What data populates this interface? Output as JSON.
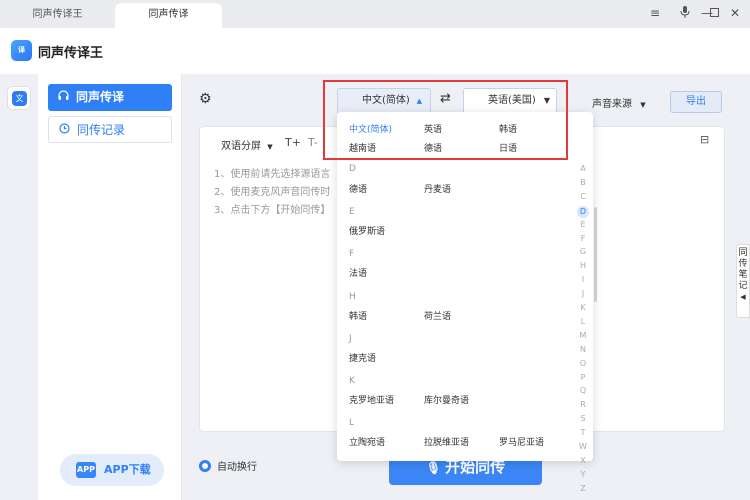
{
  "tabs": [
    "同声传译王",
    "同声传译"
  ],
  "window_controls": [
    "≡",
    "🎙",
    "—",
    "☐",
    "✕"
  ],
  "app": {
    "title": "同声传译王",
    "logo_text": "译"
  },
  "sidebar": {
    "items": [
      {
        "label": "同声传译",
        "icon": "headphones-icon",
        "active": true
      },
      {
        "label": "同传记录",
        "icon": "clock-icon",
        "active": false
      }
    ],
    "app_download": "APP下载"
  },
  "toolbar": {
    "source_lang": "中文(简体)",
    "target_lang": "英语(美国)",
    "audio_source": "声音来源",
    "export": "导出"
  },
  "panel": {
    "split_mode": "双语分屏",
    "font_up": "T+",
    "font_down": "T-",
    "instructions": [
      "1、使用前请先选择源语言",
      "2、使用麦克风声音同传时",
      "3、点击下方【开始同传】"
    ]
  },
  "bottom": {
    "auto_wrap": "自动换行",
    "start": "开始同传"
  },
  "side_tab": "同传笔记",
  "dropdown": {
    "recent": [
      "中文(简体)",
      "英语",
      "韩语",
      "越南语",
      "德语",
      "日语"
    ],
    "groups": [
      {
        "letter": "D",
        "langs": [
          "德语",
          "丹麦语"
        ]
      },
      {
        "letter": "E",
        "langs": [
          "俄罗斯语"
        ]
      },
      {
        "letter": "F",
        "langs": [
          "法语"
        ]
      },
      {
        "letter": "H",
        "langs": [
          "韩语",
          "荷兰语"
        ]
      },
      {
        "letter": "J",
        "langs": [
          "捷克语"
        ]
      },
      {
        "letter": "K",
        "langs": [
          "克罗地亚语",
          "库尔曼奇语"
        ]
      },
      {
        "letter": "L",
        "langs": [
          "立陶宛语",
          "拉脱维亚语",
          "罗马尼亚语"
        ]
      }
    ],
    "alphabet": [
      "A",
      "B",
      "C",
      "D",
      "E",
      "F",
      "G",
      "H",
      "I",
      "J",
      "K",
      "L",
      "M",
      "N",
      "O",
      "P",
      "Q",
      "R",
      "S",
      "T",
      "W",
      "X",
      "Y",
      "Z"
    ],
    "active_letter": "D"
  },
  "colors": {
    "accent": "#2f7ff7",
    "highlight": "#e03a3a"
  }
}
